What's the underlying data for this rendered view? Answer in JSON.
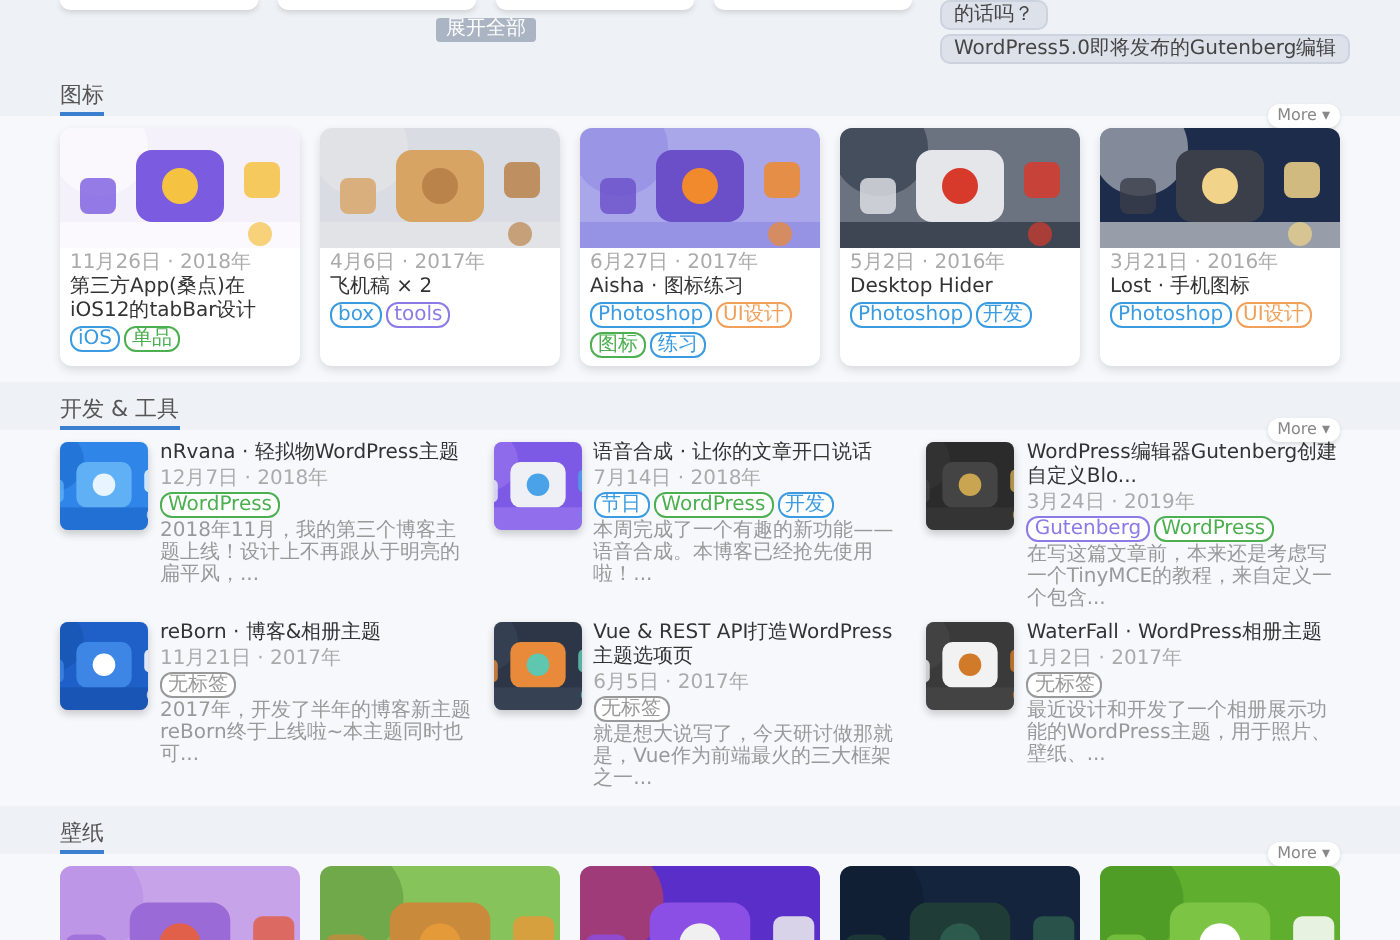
{
  "top": {
    "expand_button": "展开全部",
    "sidebar": {
      "items": [
        {
          "title": "的话吗？"
        },
        {
          "title": "WordPress5.0即将发布的Gutenberg编辑"
        }
      ]
    }
  },
  "sections": [
    {
      "kind": "cards",
      "title": "图标",
      "more": "More ▾",
      "items": [
        {
          "picture": {
            "kind": "picture"
          },
          "date": "11月26日 · 2018年",
          "title": "第三方App(桑点)在iOS12的tabBar设计",
          "tags": [
            {
              "text": "iOS",
              "color": "#3a9be0"
            },
            {
              "text": "单品",
              "color": "#4caf50"
            }
          ]
        },
        {
          "picture": {
            "kind": "picture"
          },
          "date": "4月6日 · 2017年",
          "title": "飞机稿 × 2",
          "tags": [
            {
              "text": "box",
              "color": "#3a9be0"
            },
            {
              "text": "tools",
              "color": "#8c7ae6"
            }
          ]
        },
        {
          "picture": {
            "kind": "picture"
          },
          "date": "6月27日 · 2017年",
          "title": "Aisha · 图标练习",
          "tags": [
            {
              "text": "Photoshop",
              "color": "#3a9be0"
            },
            {
              "text": "UI设计",
              "color": "#f0a05a"
            },
            {
              "text": "图标",
              "color": "#4caf50"
            },
            {
              "text": "练习",
              "color": "#3a9be0"
            }
          ]
        },
        {
          "picture": {
            "kind": "picture"
          },
          "date": "5月2日 · 2016年",
          "title": "Desktop Hider",
          "tags": [
            {
              "text": "Photoshop",
              "color": "#3a9be0"
            },
            {
              "text": "开发",
              "color": "#3a9be0"
            }
          ]
        },
        {
          "picture": {
            "kind": "picture"
          },
          "date": "3月21日 · 2016年",
          "title": "Lost · 手机图标",
          "tags": [
            {
              "text": "Photoshop",
              "color": "#3a9be0"
            },
            {
              "text": "UI设计",
              "color": "#f0a05a"
            }
          ]
        }
      ]
    },
    {
      "kind": "list",
      "title": "开发 & 工具",
      "more": "More ▾",
      "items": [
        {
          "picture": {
            "kind": "picture"
          },
          "title": "nRvana · 轻拟物WordPress主题",
          "date": "12月7日 · 2018年",
          "tags": [
            {
              "text": "WordPress",
              "color": "#4caf50"
            }
          ],
          "summary": "2018年11月，我的第三个博客主题上线！设计上不再跟从于明亮的扁平风，..."
        },
        {
          "picture": {
            "kind": "picture"
          },
          "title": "语音合成 · 让你的文章开口说话",
          "date": "7月14日 · 2018年",
          "tags": [
            {
              "text": "节日",
              "color": "#3a9be0"
            },
            {
              "text": "WordPress",
              "color": "#4caf50"
            },
            {
              "text": "开发",
              "color": "#3a9be0"
            }
          ],
          "summary": "本周完成了一个有趣的新功能——语音合成。本博客已经抢先使用啦！..."
        },
        {
          "picture": {
            "kind": "picture"
          },
          "title": "WordPress编辑器Gutenberg创建自定义Blo...",
          "date": "3月24日 · 2019年",
          "tags": [
            {
              "text": "Gutenberg",
              "color": "#8c7ae6"
            },
            {
              "text": "WordPress",
              "color": "#4caf50"
            }
          ],
          "summary": "在写这篇文章前，本来还是考虑写一个TinyMCE的教程，来自定义一个包含..."
        },
        {
          "picture": {
            "kind": "picture"
          },
          "title": "reBorn · 博客&相册主题",
          "date": "11月21日 · 2017年",
          "tags": [
            {
              "text": "无标签",
              "color": "#999999"
            }
          ],
          "summary": "2017年，开发了半年的博客新主题reBorn终于上线啦~本主题同时也可..."
        },
        {
          "picture": {
            "kind": "picture"
          },
          "title": "Vue & REST API打造WordPress主题选项页",
          "date": "6月5日 · 2017年",
          "tags": [
            {
              "text": "无标签",
              "color": "#999999"
            }
          ],
          "summary": "就是想大说写了，今天研讨做那就是，Vue作为前端最火的三大框架之一..."
        },
        {
          "picture": {
            "kind": "picture"
          },
          "title": "WaterFall · WordPress相册主题",
          "date": "1月2日 · 2017年",
          "tags": [
            {
              "text": "无标签",
              "color": "#999999"
            }
          ],
          "summary": "最近设计和开发了一个相册展示功能的WordPress主题，用于照片、壁纸、..."
        }
      ]
    },
    {
      "kind": "wallpapers",
      "title": "壁纸",
      "more": "More ▾",
      "items": [
        {
          "picture": {
            "kind": "picture"
          }
        },
        {
          "picture": {
            "kind": "picture"
          }
        },
        {
          "picture": {
            "kind": "picture"
          }
        },
        {
          "picture": {
            "kind": "picture"
          }
        },
        {
          "picture": {
            "kind": "picture"
          }
        }
      ]
    }
  ]
}
